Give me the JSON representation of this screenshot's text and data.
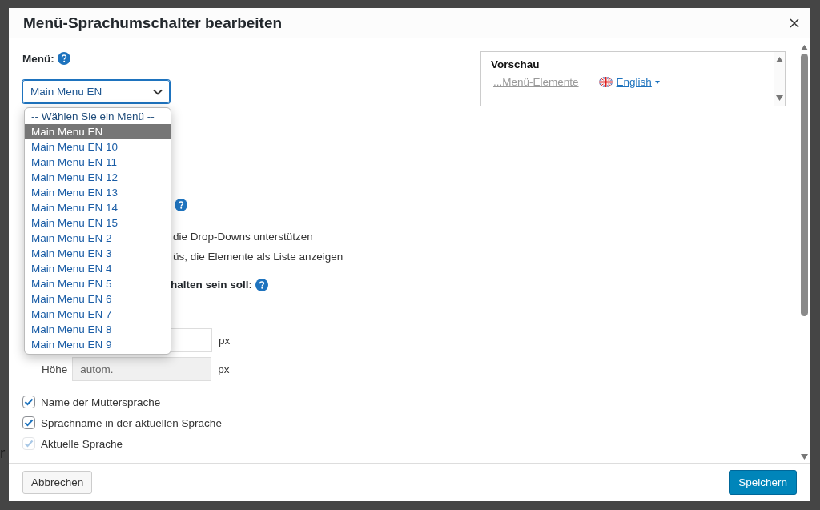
{
  "background_text": "r",
  "dialog": {
    "title": "Menü-Sprachumschalter bearbeiten"
  },
  "menu_field": {
    "label": "Menü:",
    "value": "Main Menu EN",
    "expanded": true,
    "options": [
      {
        "label": "-- Wählen Sie ein Menü --",
        "selected": false
      },
      {
        "label": "Main Menu EN",
        "selected": true
      },
      {
        "label": "Main Menu EN 10",
        "selected": false
      },
      {
        "label": "Main Menu EN 11",
        "selected": false
      },
      {
        "label": "Main Menu EN 12",
        "selected": false
      },
      {
        "label": "Main Menu EN 13",
        "selected": false
      },
      {
        "label": "Main Menu EN 14",
        "selected": false
      },
      {
        "label": "Main Menu EN 15",
        "selected": false
      },
      {
        "label": "Main Menu EN 2",
        "selected": false
      },
      {
        "label": "Main Menu EN 3",
        "selected": false
      },
      {
        "label": "Main Menu EN 4",
        "selected": false
      },
      {
        "label": "Main Menu EN 5",
        "selected": false
      },
      {
        "label": "Main Menu EN 6",
        "selected": false
      },
      {
        "label": "Main Menu EN 7",
        "selected": false
      },
      {
        "label": "Main Menu EN 8",
        "selected": false
      },
      {
        "label": "Main Menu EN 9",
        "selected": false
      }
    ]
  },
  "style_options": [
    {
      "text": "die Drop-Downs unterstützen"
    },
    {
      "text": "üs, die Elemente als Liste anzeigen"
    }
  ],
  "position_heading": "halten sein soll:",
  "width_field": {
    "unit": "px"
  },
  "height_field": {
    "label": "Höhe",
    "placeholder": "autom.",
    "unit": "px"
  },
  "checkboxes": [
    {
      "label": "Name der Muttersprache",
      "checked": true,
      "disabled": false
    },
    {
      "label": "Sprachname in der aktuellen Sprache",
      "checked": true,
      "disabled": false
    },
    {
      "label": "Aktuelle Sprache",
      "checked": true,
      "disabled": true
    }
  ],
  "preview": {
    "title": "Vorschau",
    "link": "...Menü-Elemente",
    "language": "English"
  },
  "buttons": {
    "cancel": "Abbrechen",
    "save": "Speichern"
  }
}
